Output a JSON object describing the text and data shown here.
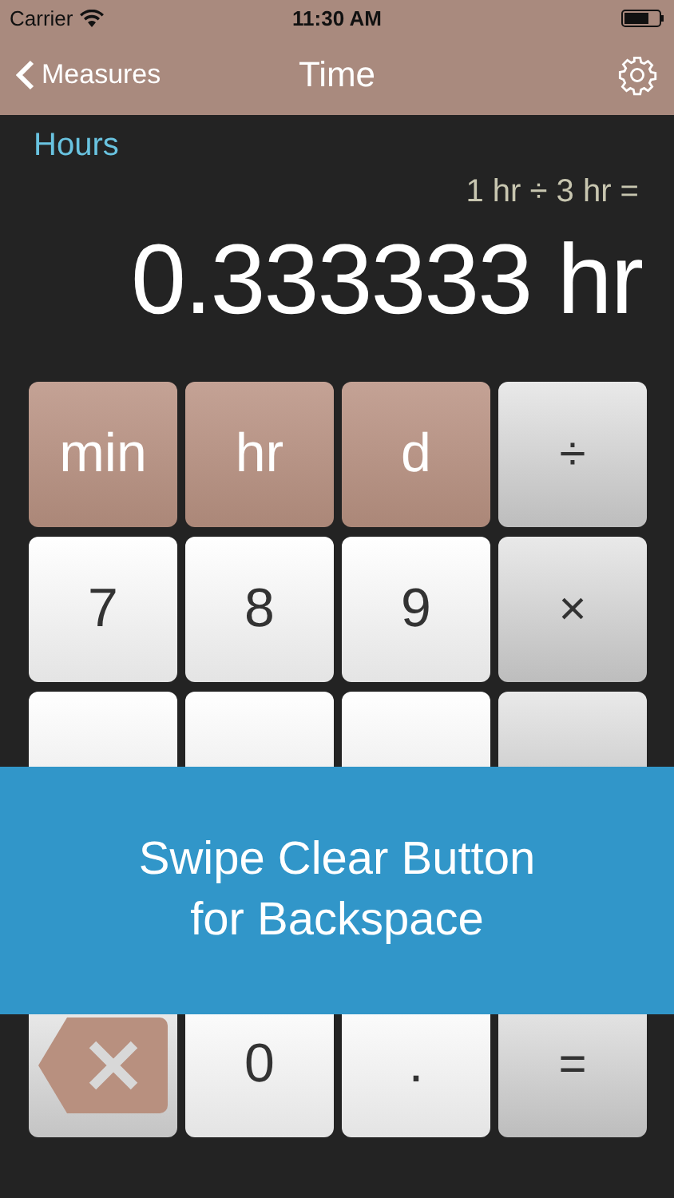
{
  "status_bar": {
    "carrier": "Carrier",
    "time": "11:30 AM"
  },
  "nav": {
    "back": "Measures",
    "title": "Time"
  },
  "display": {
    "unit": "Hours",
    "expression": "1 hr ÷ 3 hr =",
    "result": "0.333333 hr"
  },
  "keypad": [
    [
      {
        "kind": "unit",
        "label": "min"
      },
      {
        "kind": "unit",
        "label": "hr"
      },
      {
        "kind": "unit",
        "label": "d"
      },
      {
        "kind": "op",
        "label": "÷"
      }
    ],
    [
      {
        "kind": "digit",
        "label": "7"
      },
      {
        "kind": "digit",
        "label": "8"
      },
      {
        "kind": "digit",
        "label": "9"
      },
      {
        "kind": "op",
        "label": "×"
      }
    ],
    [
      {
        "kind": "digit"
      },
      {
        "kind": "digit"
      },
      {
        "kind": "digit"
      },
      {
        "kind": "op"
      }
    ],
    [
      {
        "kind": "backspace"
      },
      {
        "kind": "digit",
        "label": "0"
      },
      {
        "kind": "digit",
        "label": "."
      },
      {
        "kind": "op",
        "label": "="
      }
    ]
  ],
  "banner": {
    "text": "Swipe Clear Button\nfor Backspace"
  }
}
